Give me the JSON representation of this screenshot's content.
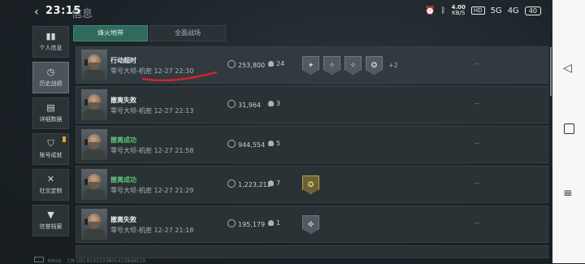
{
  "status_bar": {
    "time": "23:15",
    "title_ghost": "信息",
    "speed_value": "4.00",
    "speed_unit": "KB/S",
    "network_badge": "HD",
    "sig1": "5G",
    "sig2": "4G",
    "battery": "40"
  },
  "nav": [
    {
      "label": "个人信息",
      "icon": "bar-chart-icon",
      "glyph": "▮▮",
      "active": false,
      "badge": false
    },
    {
      "label": "历史战绩",
      "icon": "clock-icon",
      "glyph": "◷",
      "active": true,
      "badge": false
    },
    {
      "label": "详细数据",
      "icon": "cards-icon",
      "glyph": "▤",
      "active": false,
      "badge": false
    },
    {
      "label": "账号成就",
      "icon": "shield-icon",
      "glyph": "⛉",
      "active": false,
      "badge": true
    },
    {
      "label": "社交定制",
      "icon": "tools-icon",
      "glyph": "✕",
      "active": false,
      "badge": false
    },
    {
      "label": "信誉档案",
      "icon": "emblem-icon",
      "glyph": "▼",
      "active": false,
      "badge": false
    }
  ],
  "tabs": [
    {
      "label": "烽火地带",
      "active": true
    },
    {
      "label": "全面战场",
      "active": false
    }
  ],
  "records": [
    {
      "status": "行动超时",
      "status_type": "timeout",
      "map": "零号大坝-机密",
      "time": "12-27 22:30",
      "coins": "253,800",
      "kills": "24",
      "badges": [
        "✦",
        "✧",
        "✧",
        "✪"
      ],
      "badge_gold": [
        false,
        false,
        false,
        false
      ],
      "more": "+2",
      "extra": "--"
    },
    {
      "status": "撤离失败",
      "status_type": "fail",
      "map": "零号大坝-机密",
      "time": "12-27 22:13",
      "coins": "31,964",
      "kills": "3",
      "badges": [],
      "badge_gold": [],
      "more": "",
      "extra": "--"
    },
    {
      "status": "撤离成功",
      "status_type": "ok",
      "map": "零号大坝-机密",
      "time": "12-27 21:58",
      "coins": "944,554",
      "kills": "5",
      "badges": [],
      "badge_gold": [],
      "more": "",
      "extra": "--"
    },
    {
      "status": "撤离成功",
      "status_type": "ok",
      "map": "零号大坝-机密",
      "time": "12-27 21:29",
      "coins": "1,223,212",
      "kills": "7",
      "badges": [
        "✪"
      ],
      "badge_gold": [
        true
      ],
      "more": "",
      "extra": "--"
    },
    {
      "status": "撤离失败",
      "status_type": "fail",
      "map": "零号大坝-机密",
      "time": "12-27 21:18",
      "coins": "195,179",
      "kills": "1",
      "badges": [
        "✜"
      ],
      "badge_gold": [
        false
      ],
      "more": "",
      "extra": "--"
    }
  ],
  "footer": {
    "ping": "64ms",
    "uid": "CN UID:8193203801415848519"
  },
  "colors": {
    "accent_tab": "#2f6a5c",
    "success": "#5fc27e",
    "annotation": "#d8232f"
  }
}
